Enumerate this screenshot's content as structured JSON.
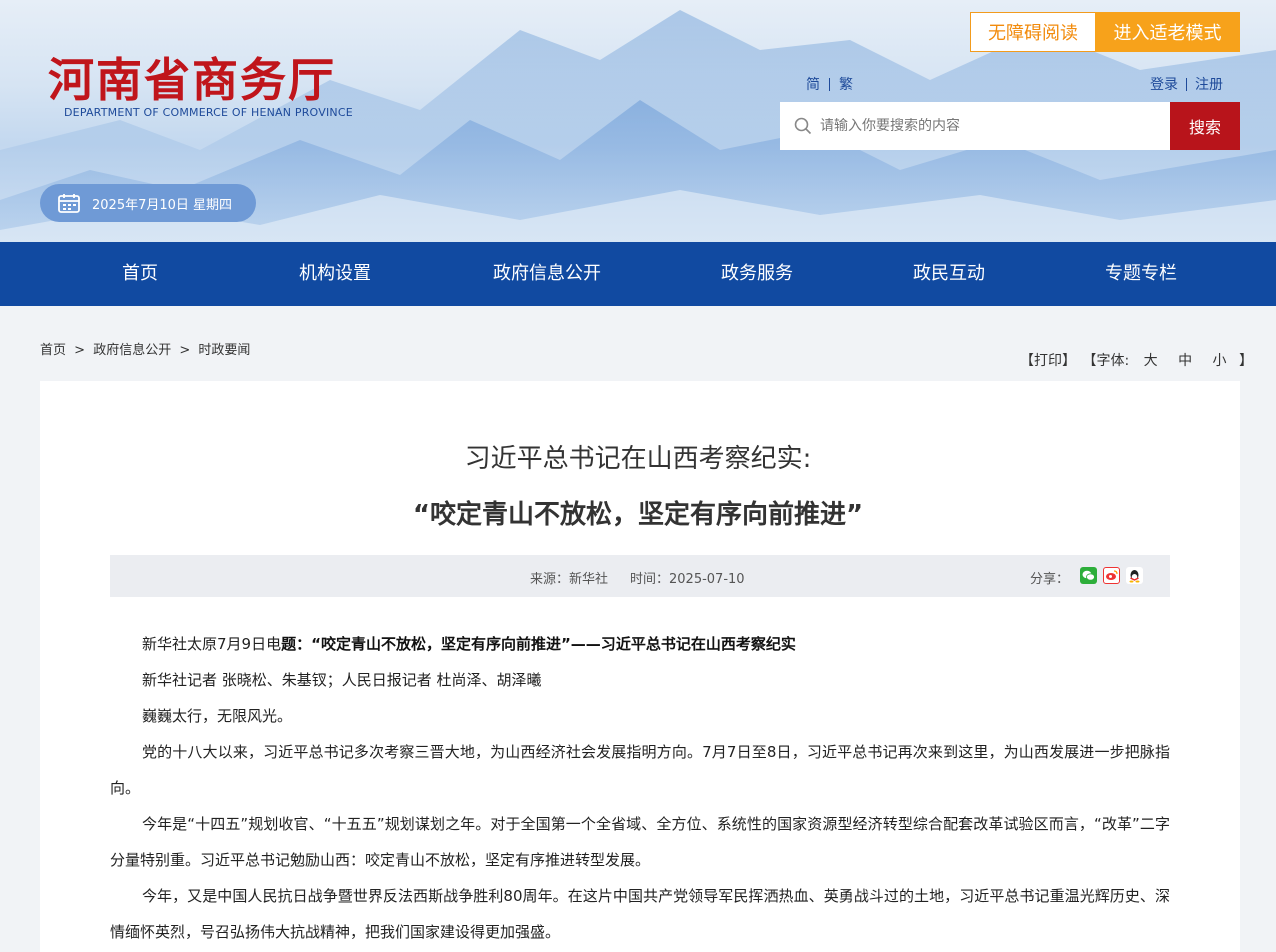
{
  "header": {
    "logo_cn": "河南省商务厅",
    "logo_en": "DEPARTMENT OF COMMERCE OF HENAN PROVINCE",
    "accessible_label": "无障碍阅读",
    "elder_mode_label": "进入适老模式",
    "lang_simplified": "简",
    "lang_traditional": "繁",
    "login_label": "登录",
    "register_label": "注册",
    "search_placeholder": "请输入你要搜索的内容",
    "search_button": "搜索",
    "date_text": "2025年7月10日 星期四",
    "colors": {
      "brand_red": "#c0151b",
      "nav_blue": "#114aa1",
      "orange": "#f7a21b"
    }
  },
  "nav": {
    "items": [
      {
        "label": "首页"
      },
      {
        "label": "机构设置"
      },
      {
        "label": "政府信息公开"
      },
      {
        "label": "政务服务"
      },
      {
        "label": "政民互动"
      },
      {
        "label": "专题专栏"
      }
    ]
  },
  "breadcrumb": {
    "home": "首页",
    "sep": ">",
    "level2": "政府信息公开",
    "level3": "时政要闻"
  },
  "tools": {
    "print": "【打印】",
    "font_prefix": "【字体:",
    "font_large": "大",
    "font_medium": "中",
    "font_small": "小",
    "font_suffix": "】"
  },
  "article": {
    "title_line1": "习近平总书记在山西考察纪实:",
    "title_line2": "“咬定青山不放松，坚定有序向前推进”",
    "source": "来源：新华社",
    "time": "时间：2025-07-10",
    "share_label": "分享：",
    "share_icons": [
      "wechat-icon",
      "weibo-icon",
      "qq-icon"
    ],
    "p1_lead": "新华社太原7月9日电",
    "p1_bold": "题：“咬定青山不放松，坚定有序向前推进”——习近平总书记在山西考察纪实",
    "p2": "新华社记者 张晓松、朱基钗；人民日报记者 杜尚泽、胡泽曦",
    "p3": "巍巍太行，无限风光。",
    "p4": "党的十八大以来，习近平总书记多次考察三晋大地，为山西经济社会发展指明方向。7月7日至8日，习近平总书记再次来到这里，为山西发展进一步把脉指向。",
    "p5": "今年是“十四五”规划收官、“十五五”规划谋划之年。对于全国第一个全省域、全方位、系统性的国家资源型经济转型综合配套改革试验区而言，“改革”二字分量特别重。习近平总书记勉励山西：咬定青山不放松，坚定有序推进转型发展。",
    "p6": "今年，又是中国人民抗日战争暨世界反法西斯战争胜利80周年。在这片中国共产党领导军民挥洒热血、英勇战斗过的土地，习近平总书记重温光辉历史、深情缅怀英烈，号召弘扬伟大抗战精神，把我们国家建设得更加强盛。"
  }
}
